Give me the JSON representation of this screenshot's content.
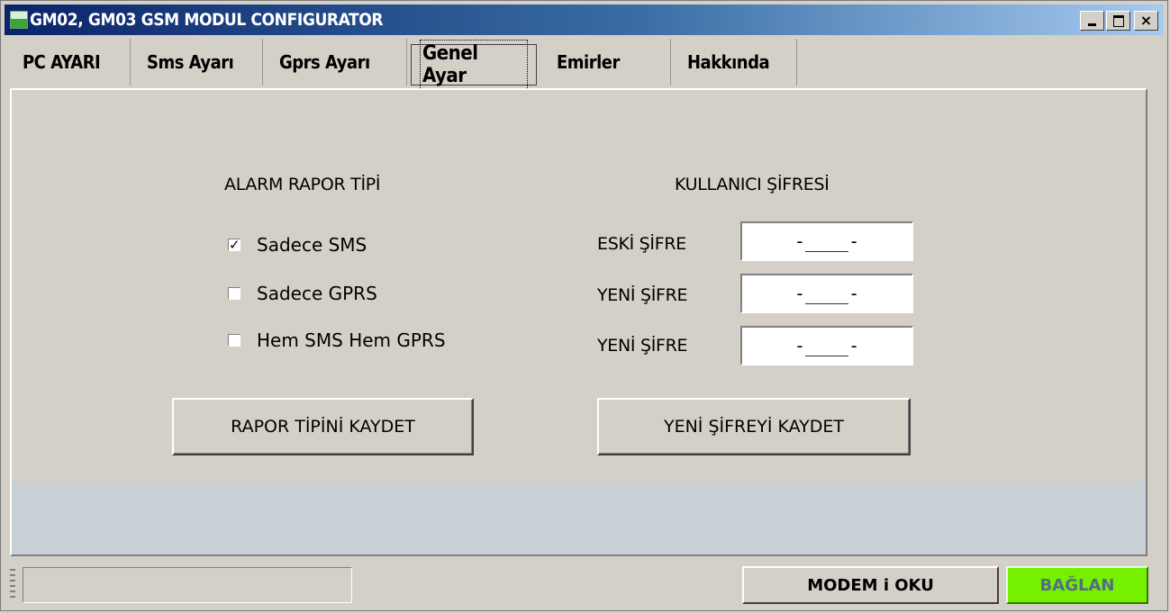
{
  "window": {
    "title": "GM02, GM03 GSM MODUL CONFIGURATOR",
    "controls": {
      "minimize": "_",
      "maximize": "□",
      "close": "×"
    }
  },
  "tabs": [
    {
      "label": "PC AYARI",
      "active": false
    },
    {
      "label": "Sms Ayarı",
      "active": false
    },
    {
      "label": "Gprs Ayarı",
      "active": false
    },
    {
      "label": "Genel Ayar",
      "active": true
    },
    {
      "label": "Emirler",
      "active": false
    },
    {
      "label": "Hakkında",
      "active": false
    }
  ],
  "alarm": {
    "title": "ALARM RAPOR TİPİ",
    "options": [
      {
        "label": "Sadece SMS",
        "checked": true,
        "mark": "✓"
      },
      {
        "label": "Sadece GPRS",
        "checked": false,
        "mark": ""
      },
      {
        "label": "Hem SMS Hem GPRS",
        "checked": false,
        "mark": ""
      }
    ],
    "save_button": "RAPOR TİPİNİ KAYDET"
  },
  "password": {
    "title": "KULLANICI ŞİFRESİ",
    "fields": [
      {
        "label": "ESKİ ŞİFRE",
        "value": "-____-"
      },
      {
        "label": "YENİ ŞİFRE",
        "value": "-____-"
      },
      {
        "label": "YENİ ŞİFRE",
        "value": "-____-"
      }
    ],
    "save_button": "YENİ ŞİFREYİ KAYDET"
  },
  "statusbar": {
    "status_text": "",
    "modem_button": "MODEM i OKU",
    "connect_button": "BAĞLAN"
  },
  "colors": {
    "face": "#d4d0c8",
    "titlebar_start": "#0a246a",
    "titlebar_end": "#a6caf0",
    "connect_bg": "#74f000",
    "connect_text": "#566b88",
    "panel_lower": "#c8d0d6"
  }
}
